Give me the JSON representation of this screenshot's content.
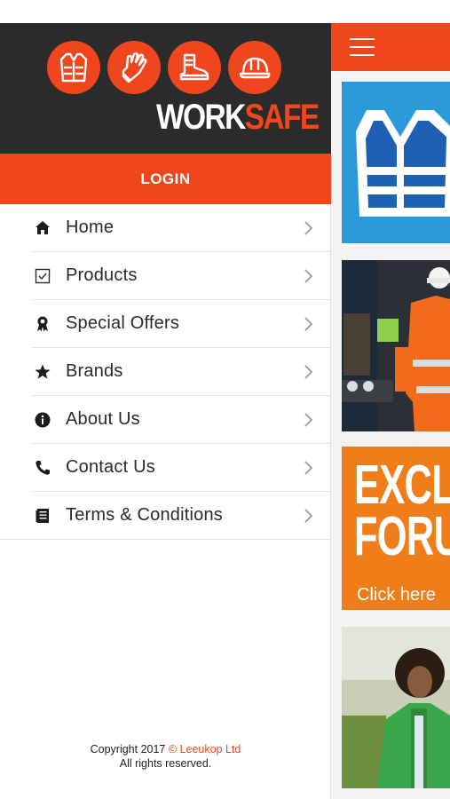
{
  "colors": {
    "accent": "#f0461e",
    "header_bg": "#2b2b2b",
    "promo_orange": "#ef7d1a",
    "vest_blue": "#2a9ad8"
  },
  "brand": {
    "word_part1": "WORK",
    "word_part2": "SAFE",
    "icons": [
      "vest-icon",
      "glove-icon",
      "boot-icon",
      "hard-hat-icon"
    ]
  },
  "drawer": {
    "login_label": "LOGIN",
    "items": [
      {
        "label": "Home",
        "icon": "home-icon"
      },
      {
        "label": "Products",
        "icon": "checkbox-icon"
      },
      {
        "label": "Special Offers",
        "icon": "award-ribbon-icon"
      },
      {
        "label": "Brands",
        "icon": "star-icon"
      },
      {
        "label": "About Us",
        "icon": "info-icon"
      },
      {
        "label": "Contact Us",
        "icon": "phone-icon"
      },
      {
        "label": "Terms & Conditions",
        "icon": "document-icon"
      }
    ],
    "copyright_prefix": "Copyright 2017 ",
    "copyright_link": "© Leeukop Ltd",
    "copyright_line2": "All rights reserved."
  },
  "content": {
    "menu_icon": "hamburger-icon",
    "promo_line1": "EXCL",
    "promo_line2": "FORU",
    "promo_cta": "Click here"
  }
}
